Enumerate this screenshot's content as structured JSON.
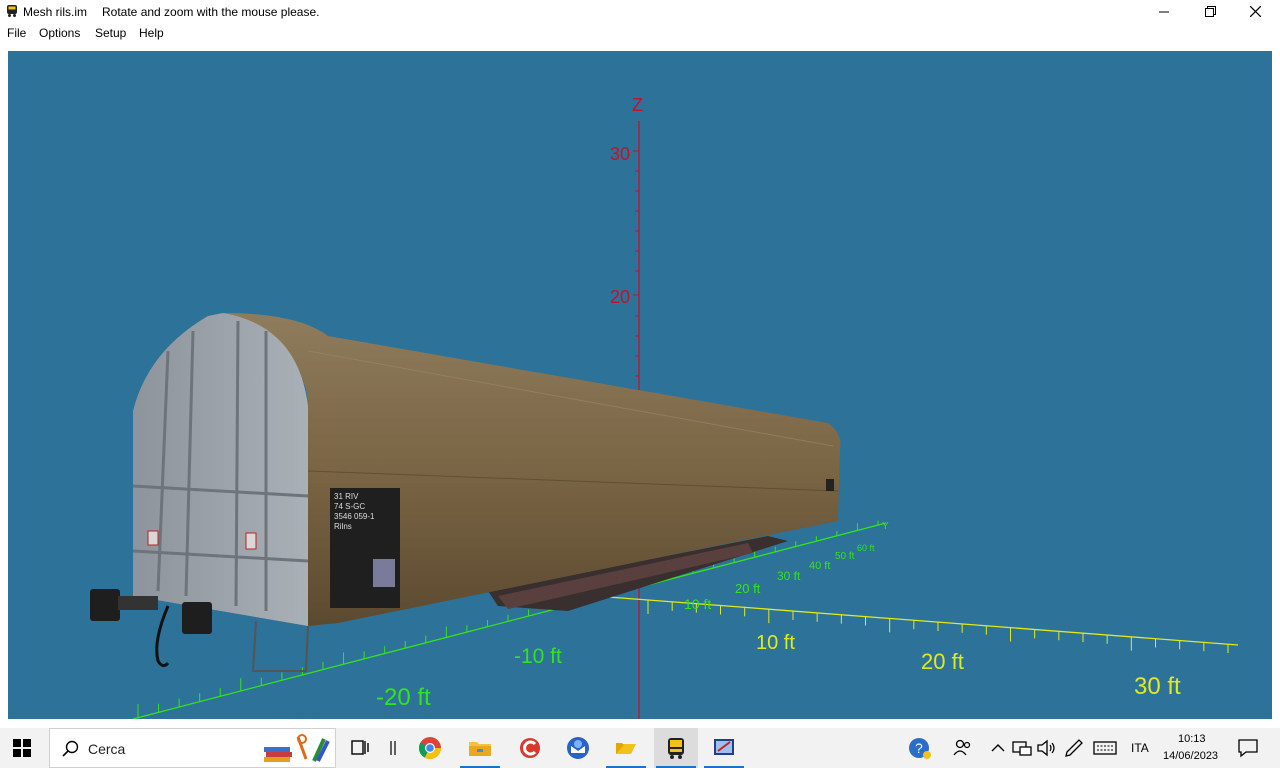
{
  "window": {
    "app_name": "Mesh rils.im",
    "message": "Rotate and zoom with the mouse please."
  },
  "menu": {
    "items": [
      "File",
      "Options",
      "Setup",
      "Help"
    ]
  },
  "viewport": {
    "background": "#2c7299",
    "z_axis": {
      "label": "Z",
      "ticks": [
        "30",
        "20"
      ],
      "color": "#c0142b"
    },
    "x_axis": {
      "ticks": [
        "10 ft",
        "20 ft",
        "30 ft"
      ],
      "color": "#e3ea1a"
    },
    "y_axis": {
      "ticks_near": [
        "-10 ft",
        "-20 ft"
      ],
      "ticks_far": [
        "10 ft",
        "20 ft",
        "30 ft",
        "40 ft",
        "50 ft",
        "60 ft"
      ],
      "end_label": "Y",
      "color": "#35e31a"
    },
    "model": {
      "description_icon": "freight-wagon-model",
      "placard_lines": [
        "31 RIV",
        "74 S-GC",
        "3546 059-1",
        "Rilns"
      ]
    }
  },
  "taskbar": {
    "search_label": "Cerca",
    "icons": [
      "windows-start-icon",
      "search-icon",
      "books-decoration-icon",
      "task-view-icon",
      "chrome-icon",
      "file-explorer-icon",
      "ccleaner-icon",
      "thunderbird-icon",
      "folder-icon",
      "train-app-icon",
      "editor-app-icon"
    ],
    "tray": {
      "language": "ITA",
      "time": "10:13",
      "date": "14/06/2023"
    }
  }
}
